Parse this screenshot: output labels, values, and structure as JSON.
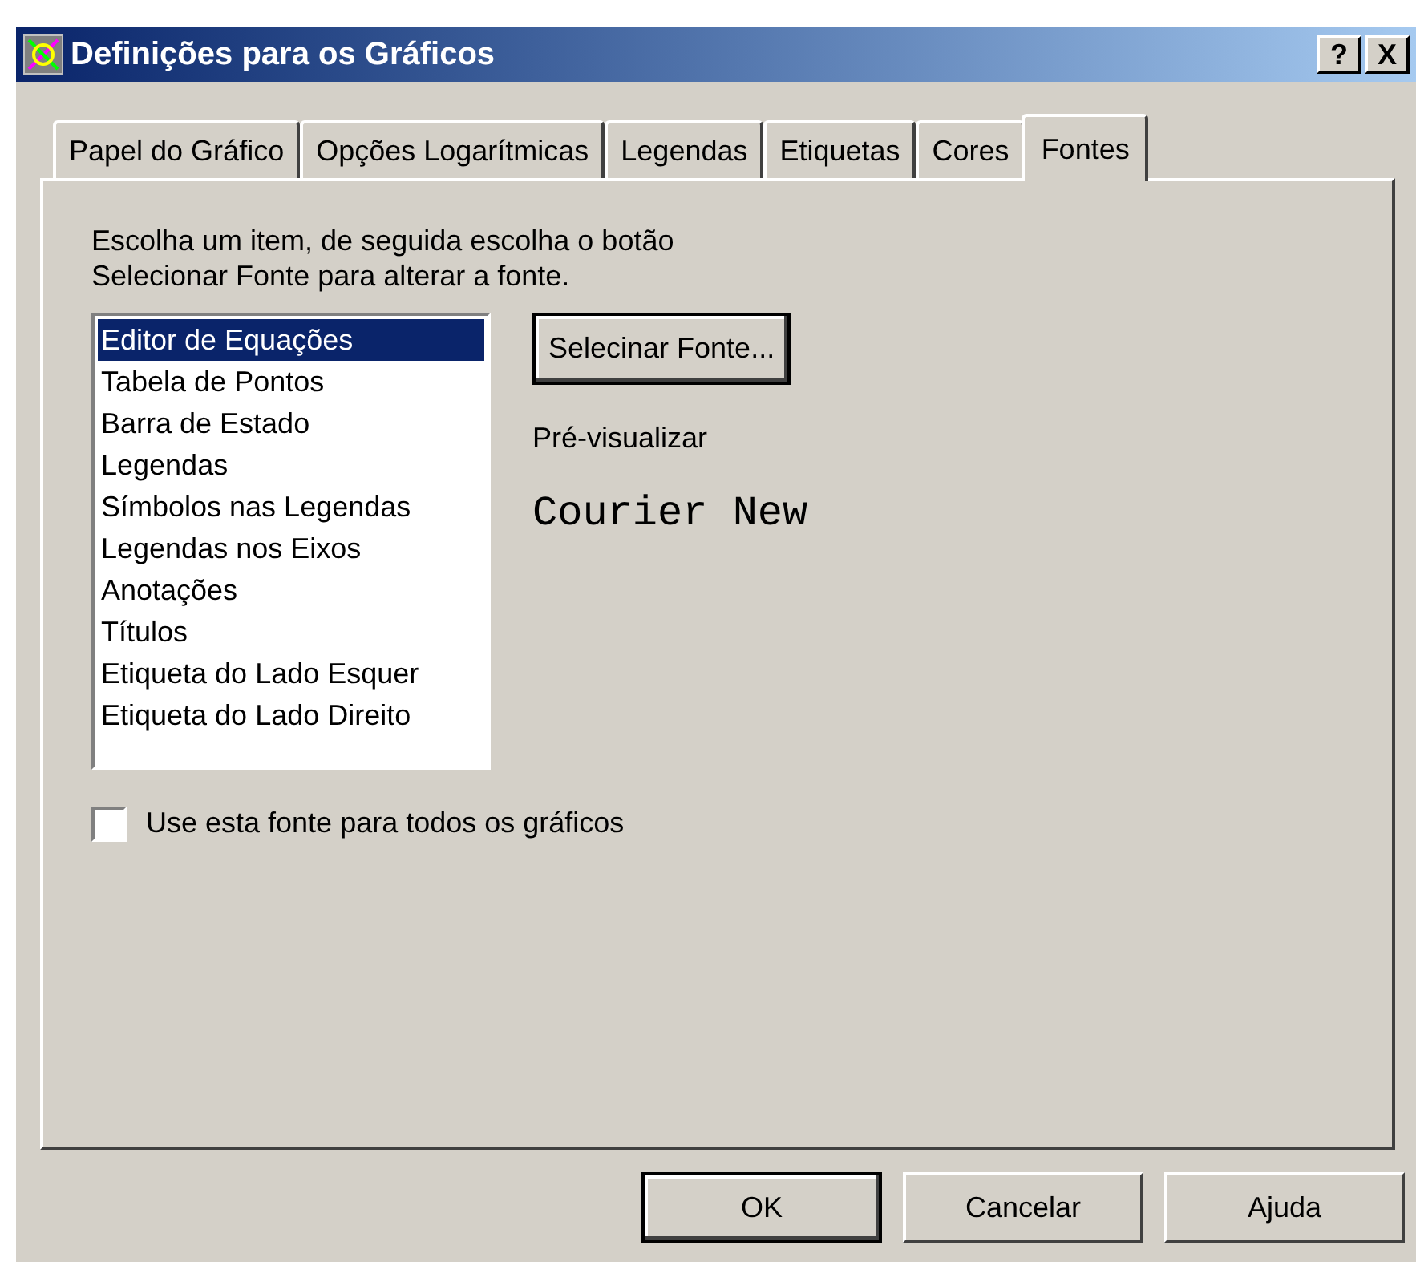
{
  "window": {
    "title": "Definições para os Gráficos",
    "help_button": "?",
    "close_button": "X"
  },
  "tabs": [
    {
      "label": "Papel do Gráfico",
      "selected": false
    },
    {
      "label": "Opções Logarítmicas",
      "selected": false
    },
    {
      "label": "Legendas",
      "selected": false
    },
    {
      "label": "Etiquetas",
      "selected": false
    },
    {
      "label": "Cores",
      "selected": false
    },
    {
      "label": "Fontes",
      "selected": true
    }
  ],
  "instructions": [
    "Escolha um item, de seguida escolha o botão",
    "Selecionar Fonte para alterar a fonte."
  ],
  "items": [
    {
      "label": "Editor de Equações",
      "selected": true
    },
    {
      "label": "Tabela de Pontos",
      "selected": false
    },
    {
      "label": "Barra de Estado",
      "selected": false
    },
    {
      "label": "Legendas",
      "selected": false
    },
    {
      "label": "Símbolos nas Legendas",
      "selected": false
    },
    {
      "label": "Legendas nos Eixos",
      "selected": false
    },
    {
      "label": "Anotações",
      "selected": false
    },
    {
      "label": "Títulos",
      "selected": false
    },
    {
      "label": "Etiqueta do Lado Esquer",
      "selected": false
    },
    {
      "label": "Etiqueta do Lado Direito",
      "selected": false
    }
  ],
  "select_font_button": "Selecinar Fonte...",
  "preview_label": "Pré-visualizar",
  "preview_text": "Courier New",
  "use_for_all": {
    "label": "Use esta fonte para todos os gráficos",
    "checked": false
  },
  "buttons": [
    {
      "label": "OK",
      "default": true
    },
    {
      "label": "Cancelar",
      "default": false
    },
    {
      "label": "Ajuda",
      "default": false
    }
  ]
}
